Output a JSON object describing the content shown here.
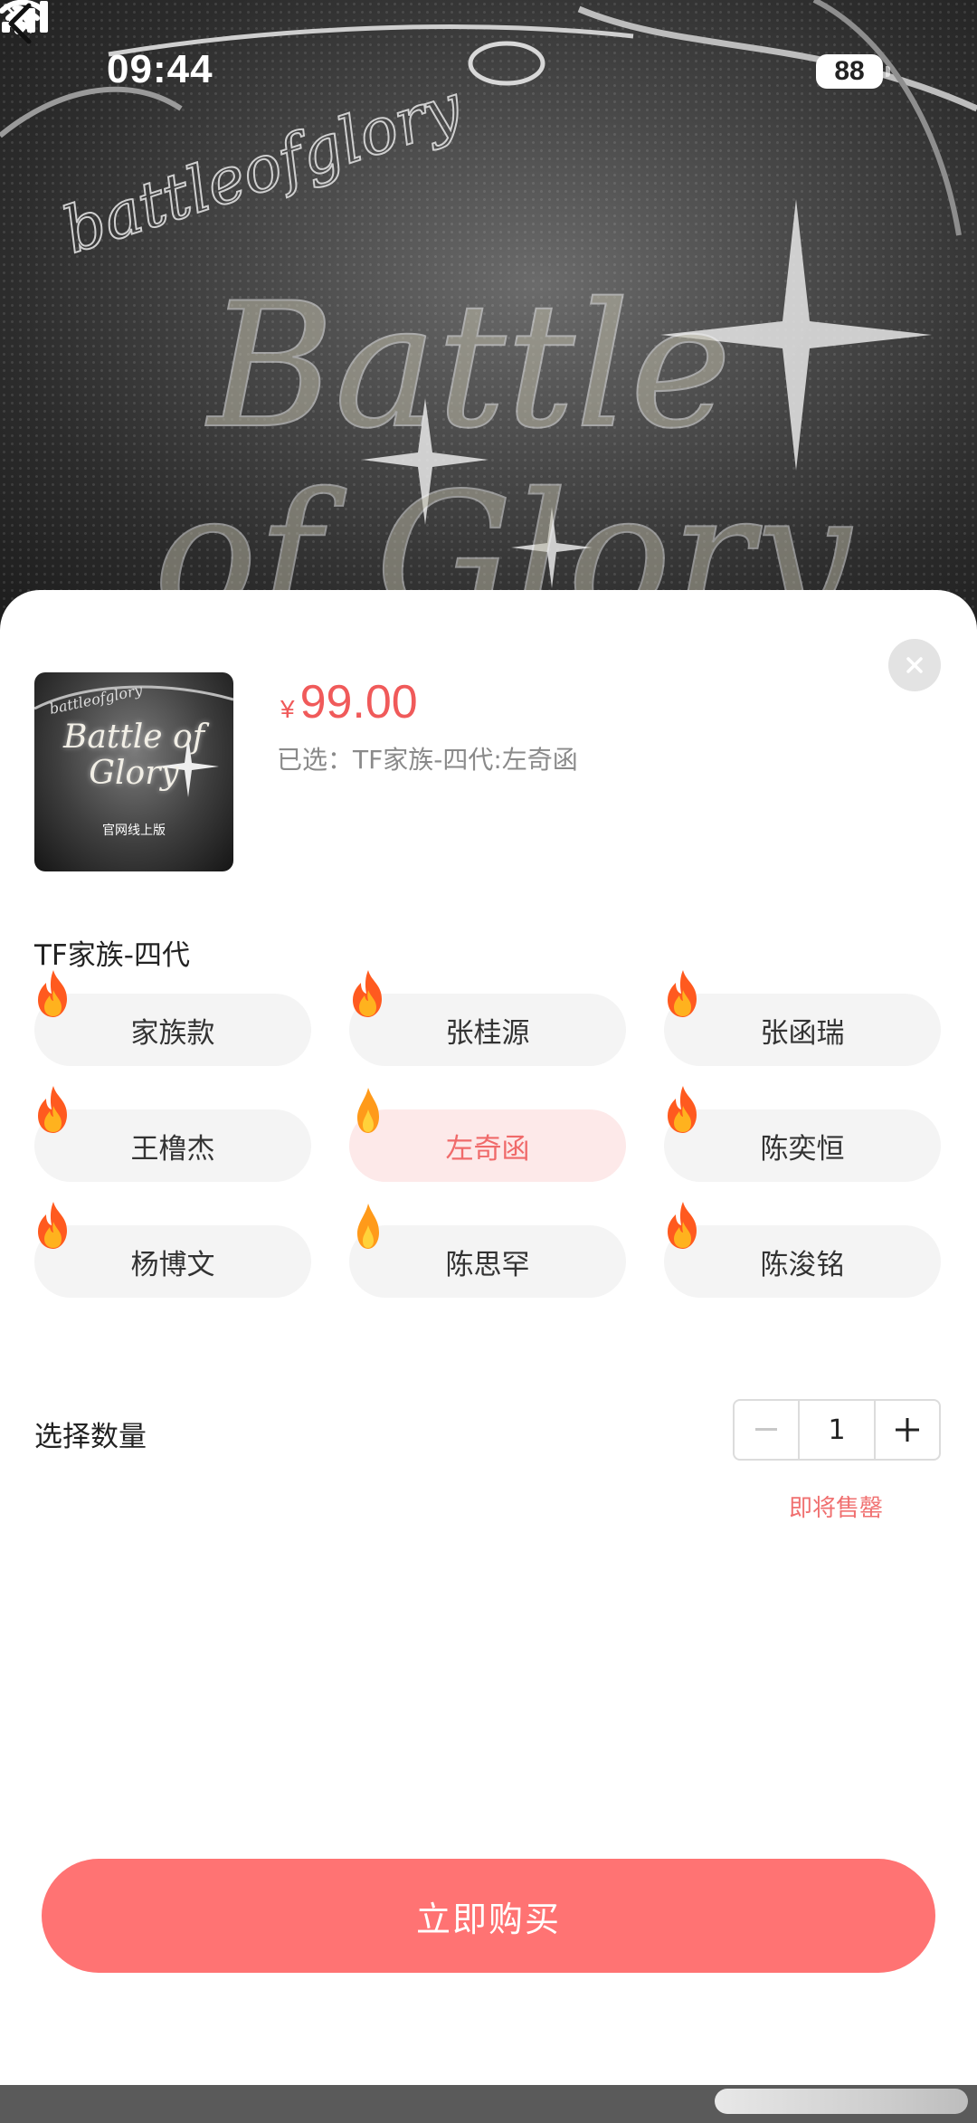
{
  "status_bar": {
    "time": "09:44",
    "battery": "88",
    "icons": [
      "bell-slash-icon",
      "signal-icon",
      "wifi-icon",
      "battery-icon"
    ]
  },
  "banner": {
    "script_small": "battleofglory",
    "script_large_line1": "Battle",
    "script_large_line2": "of Glory"
  },
  "product": {
    "thumbnail": {
      "script": "Battle of Glory",
      "script_small": "battleofglory",
      "subtitle": "官网线上版"
    },
    "price_symbol": "¥",
    "price": "99.00",
    "selected_label": "已选：TF家族-四代:左奇函"
  },
  "variant_group": {
    "title": "TF家族-四代",
    "options": [
      {
        "label": "家族款",
        "selected": false,
        "hot": "high"
      },
      {
        "label": "张桂源",
        "selected": false,
        "hot": "high"
      },
      {
        "label": "张函瑞",
        "selected": false,
        "hot": "high"
      },
      {
        "label": "王橹杰",
        "selected": false,
        "hot": "high"
      },
      {
        "label": "左奇函",
        "selected": true,
        "hot": "low"
      },
      {
        "label": "陈奕恒",
        "selected": false,
        "hot": "high"
      },
      {
        "label": "杨博文",
        "selected": false,
        "hot": "high"
      },
      {
        "label": "陈思罕",
        "selected": false,
        "hot": "low"
      },
      {
        "label": "陈浚铭",
        "selected": false,
        "hot": "high"
      }
    ]
  },
  "quantity": {
    "label": "选择数量",
    "value": "1",
    "minus": "−",
    "plus": "+",
    "note": "即将售罄"
  },
  "buy_button": "立即购买",
  "colors": {
    "accent": "#ff7373",
    "price": "#f05a5a",
    "selected_bg": "#fde9e9",
    "option_bg": "#f4f4f4"
  }
}
